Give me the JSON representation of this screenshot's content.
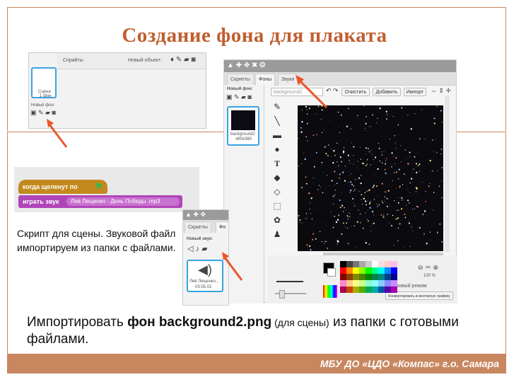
{
  "title": "Создание фона для плаката",
  "sprites_panel": {
    "header_label": "Спрайты",
    "new_object_label": "Новый объект:",
    "stage_label": "Сцена",
    "stage_count": "1 фон",
    "new_backdrop_label": "Новый фон:"
  },
  "editor": {
    "tabs": [
      "Скрипты",
      "Фоны",
      "Звуки"
    ],
    "new_backdrop_label": "Новый фон:",
    "backdrop_name": "background2",
    "clear_button": "Очистить",
    "add_button": "Добавить",
    "import_button": "Импорт",
    "thumb_name": "background2",
    "thumb_size": "480x360",
    "zoom_value": "100 %",
    "bitmap_mode_label": "Растровый режим",
    "convert_vector_label": "Конвертировать в векторную графику"
  },
  "script": {
    "hat_block": "когда щелкнут по",
    "sound_block": "играть звук",
    "sound_name": "Лев Лещенко - День Победы .mp3"
  },
  "sound_panel": {
    "tabs": [
      "Скрипты",
      "Фо"
    ],
    "new_sound_label": "Новый звук:",
    "sound_item_name": "Лев Лещенко...",
    "sound_item_duration": "03:55.02"
  },
  "caption": "Скрипт для сцены. Звуковой файл импортируем из папки с файлами.",
  "instruction": {
    "part1": "Импортировать ",
    "bold": "фон background2.png",
    "small": " (для сцены)",
    "part2": " из папки с готовыми файлами."
  },
  "footer": "МБУ ДО «ЦДО «Компас» г.о. Самара",
  "colors": {
    "accent": "#c8875f",
    "title": "#c05f30",
    "arrow": "#e8572a",
    "selection": "#39a3e3"
  }
}
